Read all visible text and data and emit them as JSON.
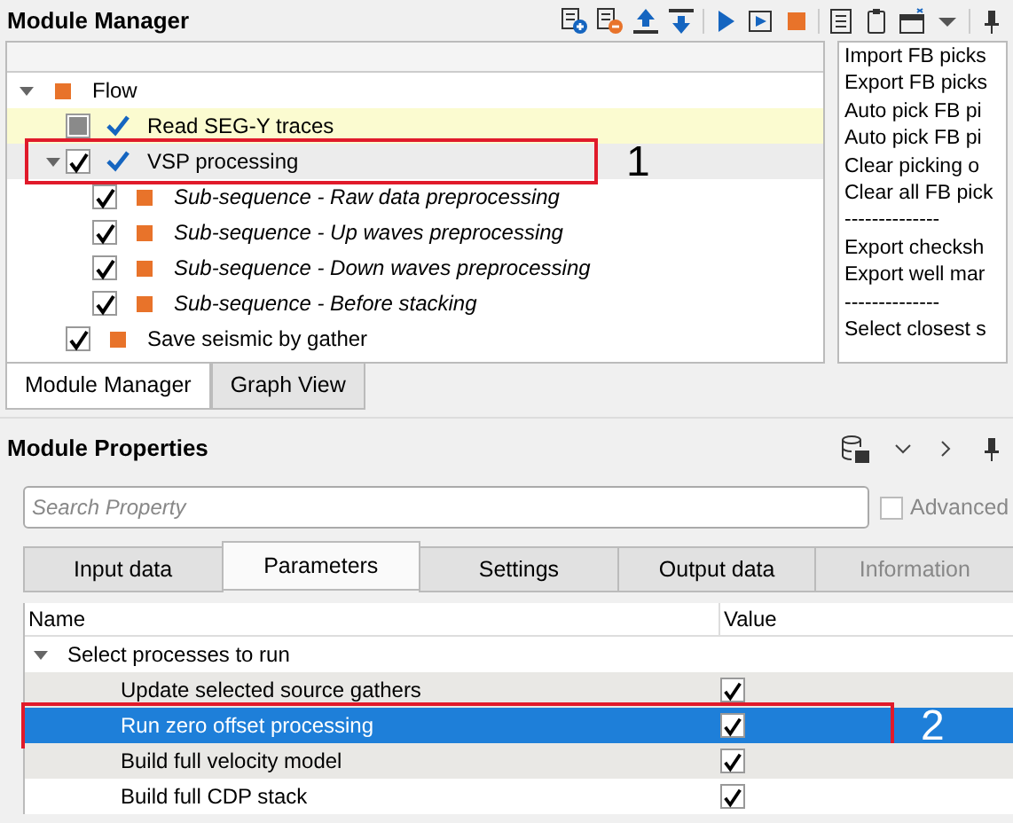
{
  "module_manager": {
    "title": "Module Manager",
    "tree": [
      {
        "label": "Flow",
        "kind": "flow",
        "done": false,
        "expanded": true,
        "selected": false,
        "highlighted": false,
        "children": [
          {
            "label": "Read SEG-Y traces",
            "kind": "module",
            "checked": false,
            "partial": true,
            "done": true,
            "selected": false,
            "highlighted": true
          },
          {
            "label": "VSP processing",
            "kind": "module",
            "checked": true,
            "partial": false,
            "done": true,
            "expanded": true,
            "selected": true,
            "highlighted": false,
            "annotation": "1",
            "children": [
              {
                "label": "Sub-sequence - Raw data preprocessing",
                "kind": "subsequence",
                "checked": true,
                "partial": false,
                "done": false,
                "selected": false,
                "highlighted": false
              },
              {
                "label": "Sub-sequence - Up waves preprocessing",
                "kind": "subsequence",
                "checked": true,
                "partial": false,
                "done": false,
                "selected": false,
                "highlighted": false
              },
              {
                "label": "Sub-sequence - Down waves preprocessing",
                "kind": "subsequence",
                "checked": true,
                "partial": false,
                "done": false,
                "selected": false,
                "highlighted": false
              },
              {
                "label": "Sub-sequence - Before stacking",
                "kind": "subsequence",
                "checked": true,
                "partial": false,
                "done": false,
                "selected": false,
                "highlighted": false
              }
            ]
          },
          {
            "label": "Save seismic by gather",
            "kind": "module",
            "checked": true,
            "partial": false,
            "done": false,
            "selected": false,
            "highlighted": false
          }
        ]
      }
    ],
    "actions": [
      "Import FB picks",
      "Export FB picks",
      "Auto pick FB pi",
      "Auto pick FB pi",
      "Clear picking o",
      "Clear all FB pick",
      "--------------",
      "Export checksh",
      "Export well mar",
      "--------------",
      "Select closest s"
    ],
    "tabs": [
      {
        "label": "Module Manager",
        "selected": true
      },
      {
        "label": "Graph View",
        "selected": false
      }
    ]
  },
  "module_properties": {
    "title": "Module Properties",
    "search": {
      "placeholder": "Search Property"
    },
    "advanced": {
      "label": "Advanced",
      "checked": false
    },
    "tabs": [
      {
        "label": "Input data",
        "selected": false,
        "disabled": false
      },
      {
        "label": "Parameters",
        "selected": true,
        "disabled": false
      },
      {
        "label": "Settings",
        "selected": false,
        "disabled": false
      },
      {
        "label": "Output data",
        "selected": false,
        "disabled": false
      },
      {
        "label": "Information",
        "selected": false,
        "disabled": true
      }
    ],
    "columns": [
      "Name",
      "Value"
    ],
    "rows": [
      {
        "label": "Select processes to run",
        "kind": "group",
        "expanded": true,
        "selected": false
      },
      {
        "label": "Update selected source gathers",
        "kind": "option",
        "checked": true,
        "selected": false
      },
      {
        "label": "Run zero offset processing",
        "kind": "option",
        "checked": true,
        "selected": true,
        "annotation": "2"
      },
      {
        "label": "Build full velocity model",
        "kind": "option",
        "checked": true,
        "selected": false
      },
      {
        "label": "Build full CDP stack",
        "kind": "option",
        "checked": true,
        "selected": false
      }
    ]
  }
}
